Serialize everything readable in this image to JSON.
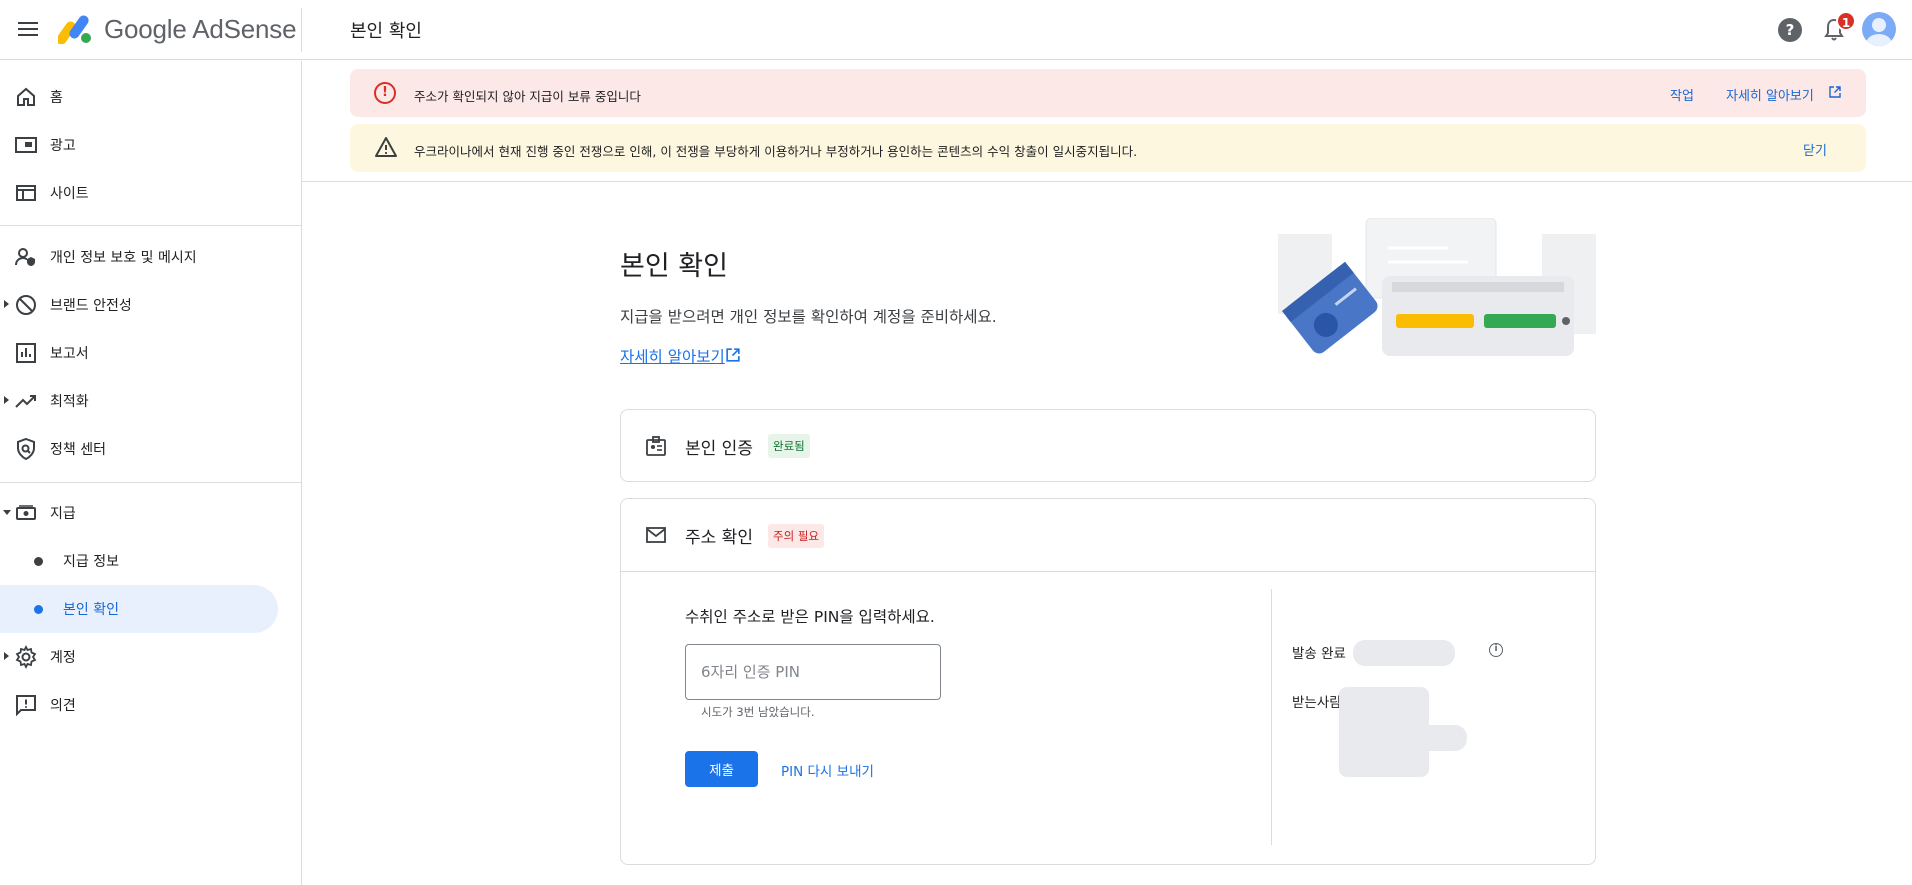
{
  "header": {
    "app_name": "Google AdSense",
    "page_title": "본인 확인",
    "help_symbol": "?",
    "notification_count": "1"
  },
  "sidebar": {
    "items": [
      {
        "label": "홈",
        "icon": "home-icon"
      },
      {
        "label": "광고",
        "icon": "ads-icon"
      },
      {
        "label": "사이트",
        "icon": "sites-icon"
      },
      {
        "label": "개인 정보 보호 및 메시지",
        "icon": "privacy-icon"
      },
      {
        "label": "브랜드 안전성",
        "icon": "brand-safety-icon"
      },
      {
        "label": "보고서",
        "icon": "reports-icon"
      },
      {
        "label": "최적화",
        "icon": "optimization-icon"
      },
      {
        "label": "정책 센터",
        "icon": "policy-icon"
      },
      {
        "label": "지급",
        "icon": "payments-icon"
      },
      {
        "label": "계정",
        "icon": "gear-icon"
      },
      {
        "label": "의견",
        "icon": "feedback-icon"
      }
    ],
    "sub_items": [
      {
        "label": "지급 정보"
      },
      {
        "label": "본인 확인",
        "active": true
      }
    ]
  },
  "banners": {
    "error": {
      "text": "주소가 확인되지 않아 지급이 보류 중입니다",
      "action": "작업",
      "learn_more": "자세히 알아보기"
    },
    "warning": {
      "text": "우크라이나에서 현재 진행 중인 전쟁으로 인해, 이 전쟁을 부당하게 이용하거나 부정하거나 용인하는 콘텐츠의 수익 창출이 일시중지됩니다.",
      "dismiss": "닫기"
    }
  },
  "main": {
    "title": "본인 확인",
    "description": "지급을 받으려면 개인 정보를 확인하여 계정을 준비하세요.",
    "learn_more": "자세히 알아보기"
  },
  "identity_card": {
    "title": "본인 인증",
    "status": "완료됨"
  },
  "address_card": {
    "title": "주소 확인",
    "status": "주의 필요",
    "pin_prompt": "수취인 주소로 받은 PIN을 입력하세요.",
    "pin_placeholder": "6자리 인증 PIN",
    "attempts_hint": "시도가 3번 남았습니다.",
    "submit_label": "제출",
    "resend_label": "PIN 다시 보내기",
    "sent_label": "발송 완료",
    "recipient_label": "받는사람"
  },
  "colors": {
    "accent": "#1a73e8",
    "error_bg": "#fce8e6",
    "warn_bg": "#fef7e0",
    "active_nav_bg": "#e8f0fe"
  }
}
